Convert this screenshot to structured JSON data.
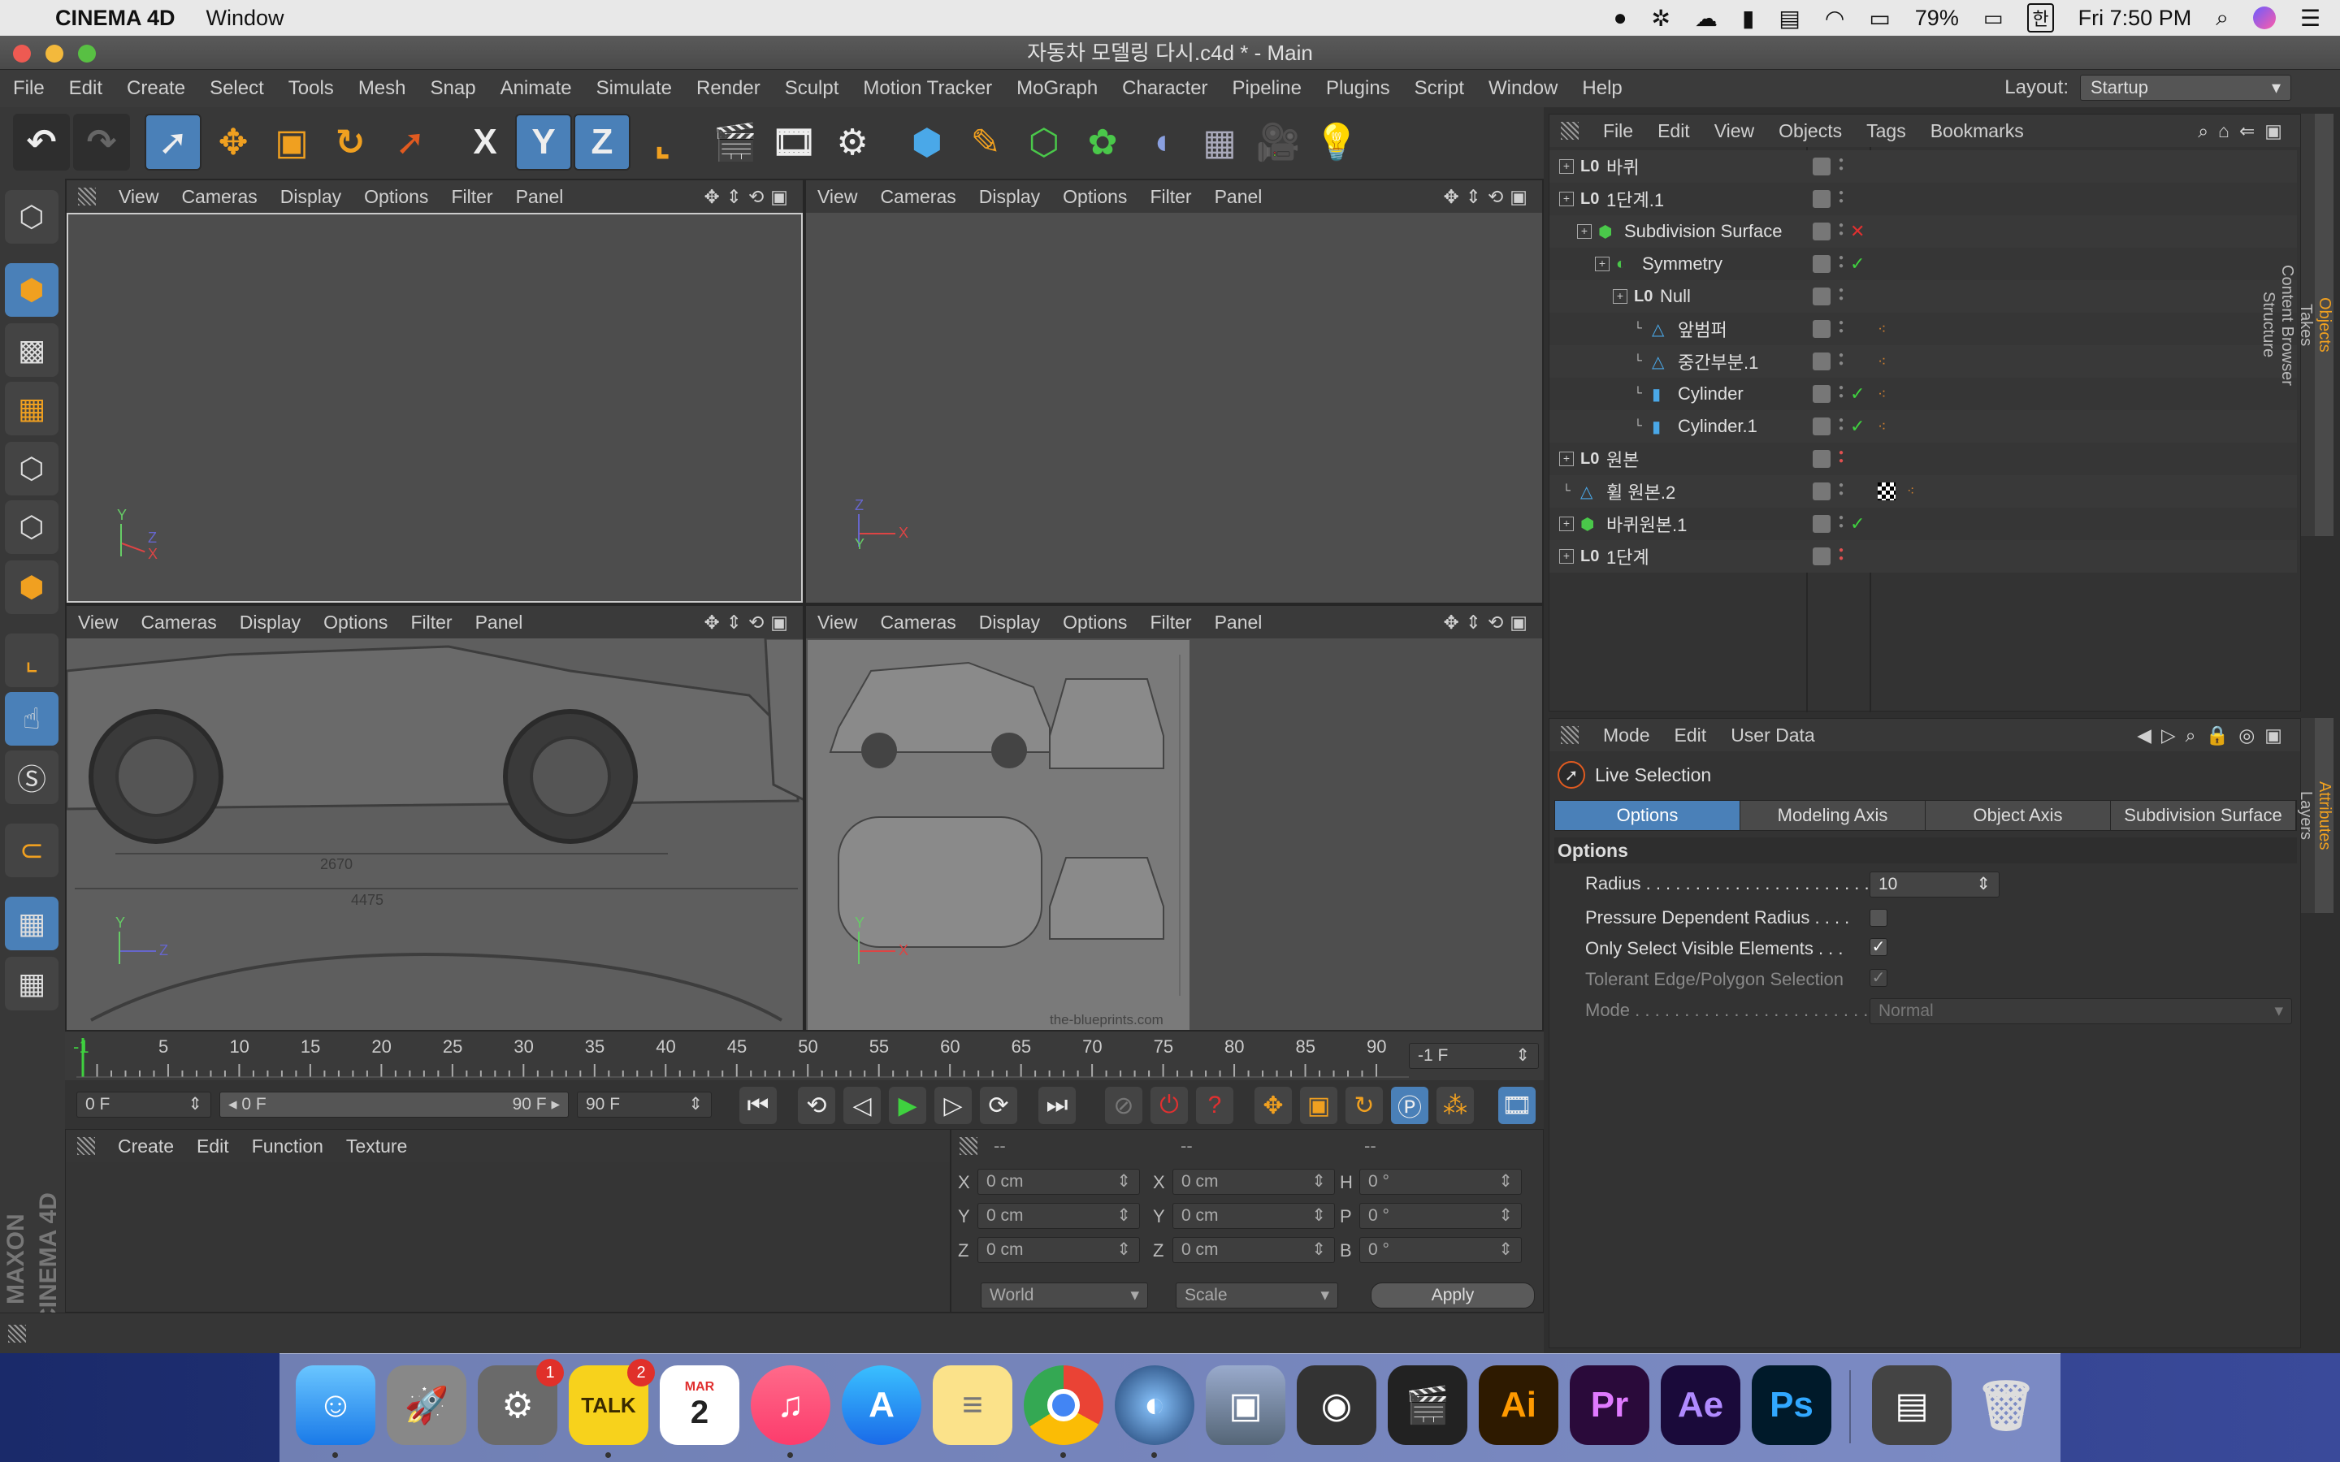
{
  "macmenu": {
    "app": "CINEMA 4D",
    "window": "Window",
    "battery": "79%",
    "clock": "Fri 7:50 PM",
    "input": "한"
  },
  "window": {
    "title": "자동차 모델링 다시.c4d * - Main"
  },
  "menu": {
    "items": [
      "File",
      "Edit",
      "Create",
      "Select",
      "Tools",
      "Mesh",
      "Snap",
      "Animate",
      "Simulate",
      "Render",
      "Sculpt",
      "Motion Tracker",
      "MoGraph",
      "Character",
      "Pipeline",
      "Plugins",
      "Script",
      "Window",
      "Help"
    ],
    "layout_label": "Layout:",
    "layout_value": "Startup"
  },
  "toolbar": {
    "x_label": "X",
    "y_label": "Y",
    "z_label": "Z"
  },
  "viewport_menu": [
    "View",
    "Cameras",
    "Display",
    "Options",
    "Filter",
    "Panel"
  ],
  "viewports": [
    {
      "label1": "2670",
      "label2": "4475",
      "axis_v": "Y",
      "axis_h": "Z"
    },
    {
      "axis_v": "Z",
      "axis_h": "X",
      "watermark": "the-blueprints.com"
    }
  ],
  "objects_menu": [
    "File",
    "Edit",
    "View",
    "Objects",
    "Tags",
    "Bookmarks"
  ],
  "objects": [
    {
      "name": "바퀴",
      "indent": 0,
      "kind": "null"
    },
    {
      "name": "1단계.1",
      "indent": 0,
      "kind": "null"
    },
    {
      "name": "Subdivision Surface",
      "indent": 1,
      "kind": "subdiv",
      "status": "x"
    },
    {
      "name": "Symmetry",
      "indent": 2,
      "kind": "sym",
      "status": "check"
    },
    {
      "name": "Null",
      "indent": 3,
      "kind": "null"
    },
    {
      "name": "앞범퍼",
      "indent": 4,
      "kind": "poly",
      "tag": "mat"
    },
    {
      "name": "중간부분.1",
      "indent": 4,
      "kind": "poly",
      "tag": "mat"
    },
    {
      "name": "Cylinder",
      "indent": 4,
      "kind": "cyl",
      "status": "check",
      "tag": "mat"
    },
    {
      "name": "Cylinder.1",
      "indent": 4,
      "kind": "cyl",
      "status": "check",
      "tag": "mat"
    },
    {
      "name": "원본",
      "indent": 0,
      "kind": "null"
    },
    {
      "name": "휠 원본.2",
      "indent": 0,
      "kind": "poly",
      "tag": "checker"
    },
    {
      "name": "바퀴원본.1",
      "indent": 0,
      "kind": "subdiv",
      "status": "check"
    },
    {
      "name": "1단계",
      "indent": 0,
      "kind": "null"
    }
  ],
  "side_tabs_top": [
    "Objects",
    "Takes",
    "Content Browser",
    "Structure"
  ],
  "side_tabs_bottom": [
    "Attributes",
    "Layers"
  ],
  "attributes": {
    "menu": [
      "Mode",
      "Edit",
      "User Data"
    ],
    "tool_name": "Live Selection",
    "tabs": [
      "Options",
      "Modeling Axis",
      "Object Axis",
      "Subdivision Surface"
    ],
    "section": "Options",
    "rows": [
      {
        "label": "Radius . . . . . . . . . . . . . . . . . . . . . . . .",
        "value": "10"
      },
      {
        "label": "Pressure Dependent Radius . . . ."
      },
      {
        "label": "Only Select Visible Elements . . ."
      },
      {
        "label": "Tolerant Edge/Polygon Selection"
      },
      {
        "label": "Mode . . . . . . . . . . . . . . . . . . . . . . . . . .",
        "value": "Normal"
      }
    ]
  },
  "timeline": {
    "ticks": [
      "-1",
      "5",
      "10",
      "15",
      "20",
      "25",
      "30",
      "35",
      "40",
      "45",
      "50",
      "55",
      "60",
      "65",
      "70",
      "75",
      "80",
      "85",
      "90"
    ],
    "current": "-1 F",
    "start": "0 F",
    "range_start": "0 F",
    "range_end": "90 F",
    "end": "90 F"
  },
  "materials_menu": [
    "Create",
    "Edit",
    "Function",
    "Texture"
  ],
  "coords": {
    "headers": [
      "--",
      "--",
      "--"
    ],
    "rows": [
      {
        "a": "X",
        "av": "0 cm",
        "b": "X",
        "bv": "0 cm",
        "c": "H",
        "cv": "0 °"
      },
      {
        "a": "Y",
        "av": "0 cm",
        "b": "Y",
        "bv": "0 cm",
        "c": "P",
        "cv": "0 °"
      },
      {
        "a": "Z",
        "av": "0 cm",
        "b": "Z",
        "bv": "0 cm",
        "c": "B",
        "cv": "0 °"
      }
    ],
    "world": "World",
    "scale": "Scale",
    "apply": "Apply"
  },
  "branding": {
    "logo": "MAXON CINEMA 4D"
  },
  "dock": {
    "talk": "TALK",
    "talk_badge": "2",
    "prefs_badge": "1",
    "cal_month": "MAR",
    "cal_day": "2",
    "ai": "Ai",
    "pr": "Pr",
    "ae": "Ae",
    "ps": "Ps"
  }
}
